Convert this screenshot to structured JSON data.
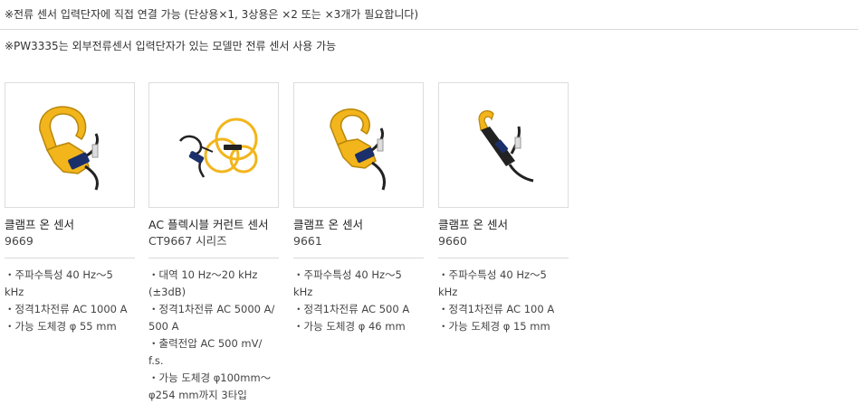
{
  "notes": [
    "※전류 센서 입력단자에 직접 연결 가능 (단상용×1, 3상용은 ×2 또는 ×3개가 필요합니다)",
    "※PW3335는 외부전류센서 입력단자가 있는 모델만 전류 센서 사용 가능"
  ],
  "products": [
    {
      "title": "클램프 온 센서",
      "model": "9669",
      "specs": [
        "・주파수특성 40 Hz～5",
        "kHz",
        "・정격1차전류 AC 1000 A",
        "・가능 도체경 φ 55 mm"
      ]
    },
    {
      "title": "AC 플렉시블 커런트 센서",
      "model": "CT9667 시리즈",
      "specs": [
        "・대역 10 Hz～20 kHz",
        "(±3dB)",
        "・정격1차전류 AC 5000 A/",
        "500 A",
        "・출력전압 AC 500 mV/ f.s.",
        "・가능 도체경 φ100mm～",
        "φ254 mm까지 3타입"
      ]
    },
    {
      "title": "클램프 온 센서",
      "model": "9661",
      "specs": [
        "・주파수특성 40 Hz～5",
        "kHz",
        "・정격1차전류 AC 500 A",
        "・가능 도체경 φ 46 mm"
      ]
    },
    {
      "title": "클램프 온 센서",
      "model": "9660",
      "specs": [
        "・주파수특성 40 Hz～5",
        "kHz",
        "・정격1차전류 AC 100 A",
        "・가능 도체경 φ 15 mm"
      ]
    }
  ]
}
